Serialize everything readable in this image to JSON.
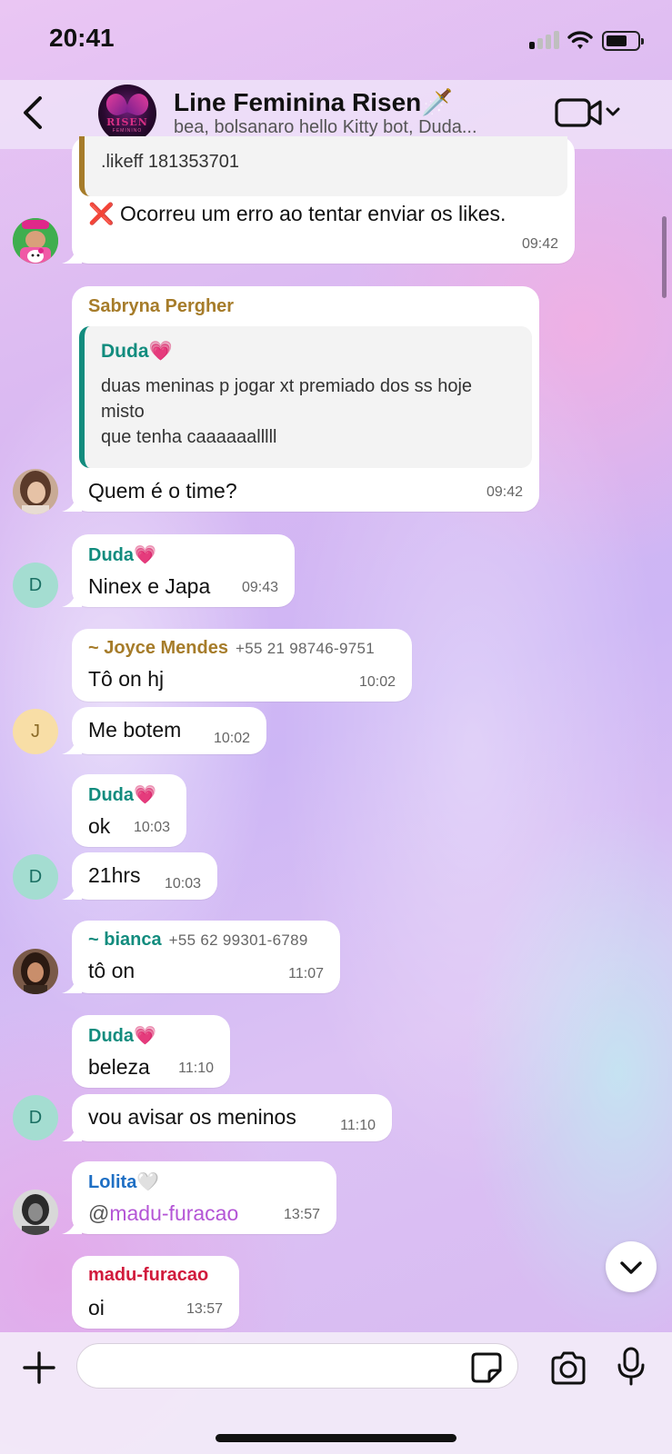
{
  "status_bar": {
    "time": "20:41"
  },
  "header": {
    "group_name": "Line Feminina Risen🗡️",
    "participants": "bea, bolsanaro hello Kitty bot, Duda...",
    "avatar_text": "RISEN",
    "avatar_subtext": "FEMININO"
  },
  "messages": [
    {
      "id": "m1",
      "text_top": ".likeff 181353701",
      "text": "❌ Ocorreu um erro ao tentar enviar os likes.",
      "time": "09:42"
    },
    {
      "id": "m2",
      "sender": "Sabryna Pergher",
      "sender_color": "#a67c2a",
      "quote_sender": "Duda💗",
      "quote_lines": [
        "duas meninas p jogar xt premiado dos ss hoje",
        "misto",
        "que tenha caaaaaalllll"
      ],
      "text": "Quem é o time?",
      "time": "09:42"
    },
    {
      "id": "m3",
      "sender": "Duda💗",
      "sender_color": "#128c7e",
      "text": "Ninex e Japa",
      "time": "09:43"
    },
    {
      "id": "m4",
      "sender": "~ Joyce Mendes",
      "phone": "+55 21 98746-9751",
      "sender_color": "#a67c2a",
      "text": "Tô on hj",
      "time": "10:02"
    },
    {
      "id": "m5",
      "text": "Me botem",
      "time": "10:02"
    },
    {
      "id": "m6",
      "sender": "Duda💗",
      "sender_color": "#128c7e",
      "text": "ok",
      "time": "10:03"
    },
    {
      "id": "m7",
      "text": "21hrs",
      "time": "10:03"
    },
    {
      "id": "m8",
      "sender": "~ bianca",
      "phone": "+55 62 99301-6789",
      "sender_color": "#128c7e",
      "text": "tô on",
      "time": "11:07"
    },
    {
      "id": "m9",
      "sender": "Duda💗",
      "sender_color": "#128c7e",
      "text": "beleza",
      "time": "11:10"
    },
    {
      "id": "m10",
      "text": "vou avisar os meninos",
      "time": "11:10"
    },
    {
      "id": "m11",
      "sender": "Lolita🤍",
      "sender_color": "#1e6fc4",
      "mention_prefix": "@",
      "mention": "madu-furacao",
      "mention_color": "#b455d6",
      "time": "13:57"
    },
    {
      "id": "m12",
      "sender": "madu-furacao",
      "sender_color": "#d11a3c",
      "text": "oi",
      "time": "13:57"
    }
  ],
  "avatars": {
    "d_letter": "D",
    "j_letter": "J"
  },
  "input": {
    "placeholder": ""
  },
  "colors": {
    "teal_sender": "#128c7e",
    "gold_sender": "#a67c2a",
    "mention": "#b455d6"
  }
}
